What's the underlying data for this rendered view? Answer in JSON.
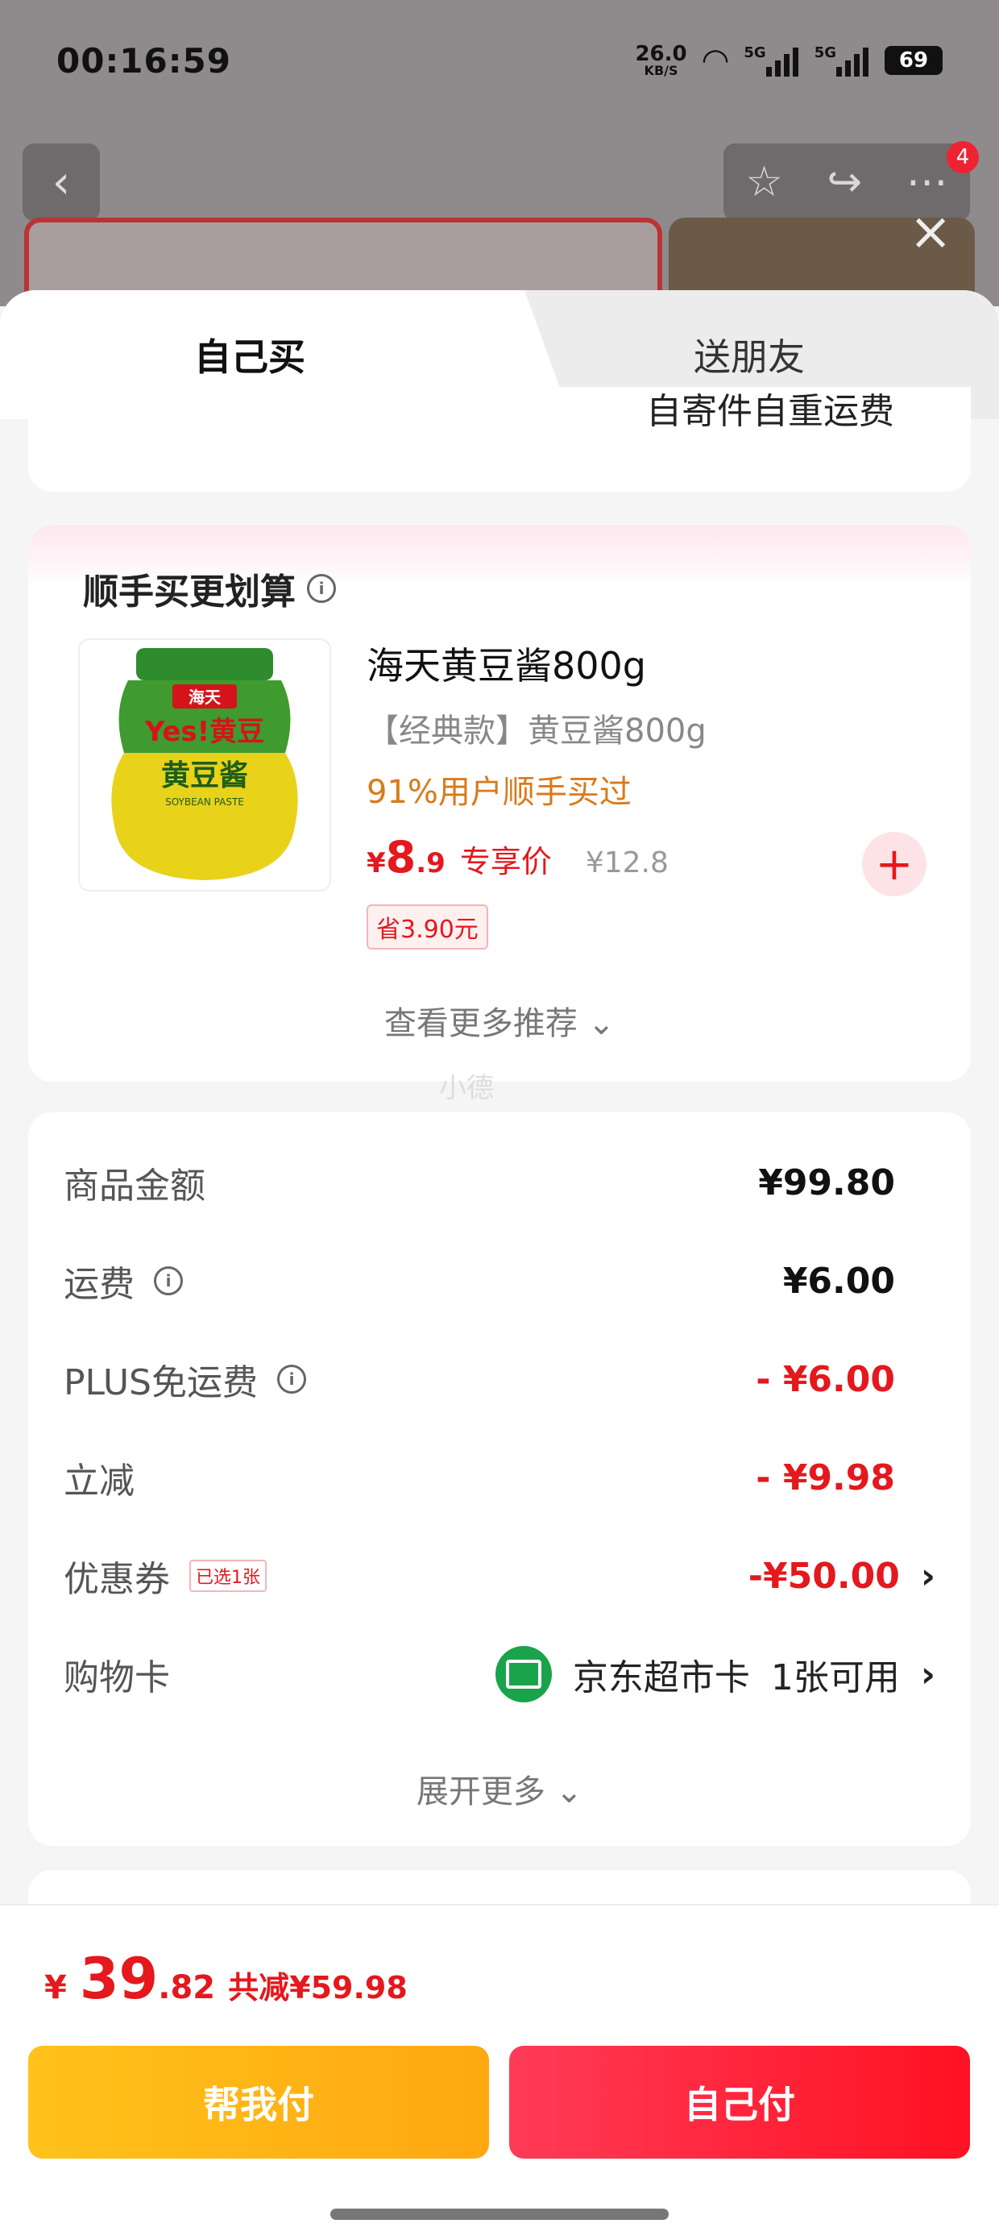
{
  "status_bar": {
    "time": "00:16:59",
    "net_speed": "26.0",
    "net_unit": "KB/S",
    "sig1": "5G",
    "sig2": "5G",
    "battery": "69"
  },
  "background": {
    "more_badge": "4"
  },
  "tabs": {
    "self_buy": "自己买",
    "gift": "送朋友"
  },
  "clipped_text": "自寄件自重运费",
  "recommend": {
    "title": "顺手买更划算",
    "product": {
      "name": "海天黄豆酱800g",
      "subtitle": "【经典款】黄豆酱800g",
      "popularity": "91%用户顺手买过",
      "price_symbol": "¥",
      "price_int": "8",
      "price_dec": ".9",
      "price_label": "专享价",
      "original_price": "¥12.8",
      "save": "省3.90元",
      "img_brand": "海天",
      "img_text": "Yes!黄豆",
      "img_name": "黄豆酱",
      "img_en": "SOYBEAN PASTE"
    },
    "more": "查看更多推荐 ⌄",
    "watermark": "小德"
  },
  "summary": {
    "items": [
      {
        "label": "商品金额",
        "value": "¥99.80"
      },
      {
        "label": "运费",
        "value": "¥6.00"
      },
      {
        "label": "PLUS免运费",
        "value": "- ¥6.00"
      },
      {
        "label": "立减",
        "value": "- ¥9.98"
      },
      {
        "label": "优惠券",
        "tag": "已选1张",
        "value": "-¥50.00"
      },
      {
        "label": "购物卡",
        "card_name": "京东超市卡",
        "value": "1张可用"
      }
    ],
    "expand": "展开更多 ⌄"
  },
  "bottom": {
    "sym": "¥",
    "int": "39",
    "dec": ".82",
    "cut": "共减¥59.98",
    "help_pay": "帮我付",
    "self_pay": "自己付"
  },
  "colors": {
    "accent_red": "#e4181d",
    "help_btn": "#ffb516",
    "self_btn": "#ff2a3c"
  }
}
